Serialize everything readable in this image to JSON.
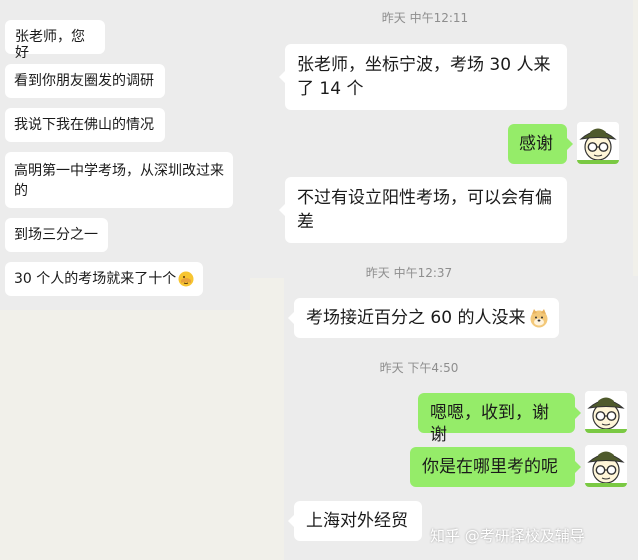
{
  "left_chat": {
    "messages": [
      "张老师，您好",
      "看到你朋友圈发的调研",
      "我说下我在佛山的情况",
      "高明第一中学考场，从深圳改过来的",
      "到场三分之一",
      "30 个人的考场就来了十个"
    ],
    "last_emoji": "facepalm-emoji"
  },
  "right_chat_1": {
    "timestamp": "昨天 中午12:11",
    "incoming_1": "张老师，坐标宁波，考场 30 人来了 14 个",
    "outgoing_1": "感谢",
    "incoming_2": "不过有设立阳性考场，可以会有偏差"
  },
  "right_chat_2": {
    "timestamp_1": "昨天 中午12:37",
    "incoming_1": "考场接近百分之 60 的人没来",
    "incoming_1_emoji": "doge-emoji",
    "timestamp_2": "昨天 下午4:50",
    "outgoing_1": "嗯嗯，收到，谢谢",
    "outgoing_2": "你是在哪里考的呢",
    "incoming_2": "上海对外经贸"
  },
  "avatar_icon": "cartoon-man-hat-glasses-icon",
  "watermark": "知乎 @考研择校及辅导",
  "colors": {
    "panel_bg": "#ececec",
    "incoming_bubble": "#ffffff",
    "outgoing_bubble": "#95ec69",
    "timestamp_text": "#8e8e8e",
    "page_bg": "#f1f0ea"
  }
}
